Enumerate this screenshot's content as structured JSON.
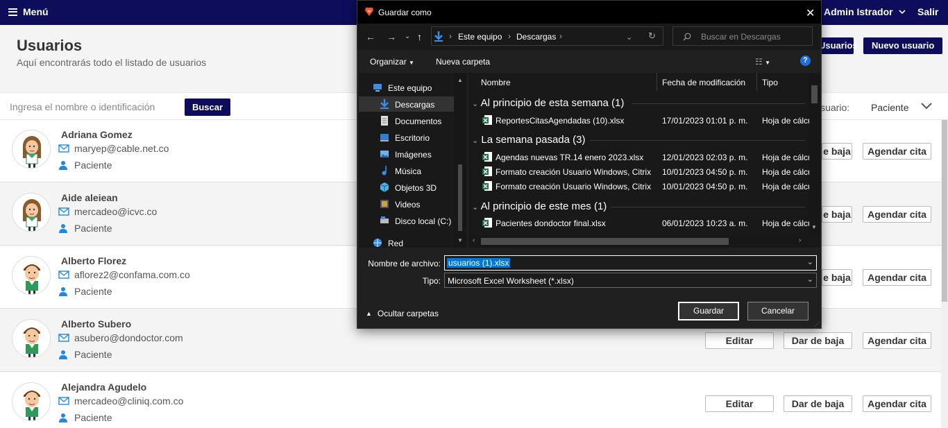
{
  "topbar": {
    "menu_label": "Menú",
    "user_label": "Admin Istrador",
    "logout_label": "Salir"
  },
  "header": {
    "title": "Usuarios",
    "subtitle": "Aquí encontrarás todo el listado de usuarios",
    "btn_partial": "Usuarios",
    "btn_new_user": "Nuevo usuario"
  },
  "search": {
    "placeholder": "Ingresa el nombre o identificación",
    "button": "Buscar",
    "filter_label": "Usuario:",
    "filter_value": "Paciente"
  },
  "users": [
    {
      "name": "Adriana Gomez",
      "email": "maryep@cable.net.co",
      "role": "Paciente",
      "gender": "female"
    },
    {
      "name": "Aide aleiean",
      "email": "mercadeo@icvc.co",
      "role": "Paciente",
      "gender": "female"
    },
    {
      "name": "Alberto Florez",
      "email": "aflorez2@confama.com.co",
      "role": "Paciente",
      "gender": "male"
    },
    {
      "name": "Alberto Subero",
      "email": "asubero@dondoctor.com",
      "role": "Paciente",
      "gender": "male"
    },
    {
      "name": "Alejandra Agudelo",
      "email": "mercadeo@cliniq.com.co",
      "role": "Paciente",
      "gender": "male"
    }
  ],
  "row_actions": {
    "edit": "Editar",
    "deactivate": "Dar de baja",
    "deactivate_partial": "e baja",
    "schedule": "Agendar cita"
  },
  "dialog": {
    "title": "Guardar como",
    "address": [
      "Este equipo",
      "Descargas"
    ],
    "search_placeholder": "Buscar en Descargas",
    "organize": "Organizar",
    "new_folder": "Nueva carpeta",
    "nav_items": [
      {
        "label": "Este equipo",
        "icon": "computer-icon"
      },
      {
        "label": "Descargas",
        "icon": "download-icon"
      },
      {
        "label": "Documentos",
        "icon": "document-icon"
      },
      {
        "label": "Escritorio",
        "icon": "desktop-icon"
      },
      {
        "label": "Imágenes",
        "icon": "pictures-icon"
      },
      {
        "label": "Música",
        "icon": "music-icon"
      },
      {
        "label": "Objetos 3D",
        "icon": "cube-icon"
      },
      {
        "label": "Videos",
        "icon": "video-icon"
      },
      {
        "label": "Disco local (C:)",
        "icon": "disk-icon"
      },
      {
        "label": "Red",
        "icon": "network-icon"
      }
    ],
    "columns": {
      "name": "Nombre",
      "date": "Fecha de modificación",
      "type": "Tipo"
    },
    "groups": [
      {
        "label": "Al principio de esta semana (1)",
        "files": [
          {
            "name": "ReportesCitasAgendadas (10).xlsx",
            "date": "17/01/2023 01:01 p. m.",
            "type": "Hoja de cálculo"
          }
        ]
      },
      {
        "label": "La semana pasada (3)",
        "files": [
          {
            "name": "Agendas nuevas TR.14 enero 2023.xlsx",
            "date": "12/01/2023 02:03 p. m.",
            "type": "Hoja de cálculo"
          },
          {
            "name": "Formato creación Usuario Windows, Citrix.xlsx",
            "date": "10/01/2023 04:50 p. m.",
            "type": "Hoja de cálculo"
          },
          {
            "name": "Formato creación Usuario Windows, Citrix.xlsx",
            "date": "10/01/2023 04:50 p. m.",
            "type": "Hoja de cálculo"
          }
        ]
      },
      {
        "label": "Al principio de este mes (1)",
        "files": [
          {
            "name": "Pacientes dondoctor final.xlsx",
            "date": "06/01/2023 10:23 a. m.",
            "type": "Hoja de cálculo"
          }
        ]
      }
    ],
    "filename_label": "Nombre de archivo:",
    "filename_value": "usuarios (1).xlsx",
    "type_label": "Tipo:",
    "type_value": "Microsoft Excel Worksheet (*.xlsx)",
    "hide_folders": "Ocultar carpetas",
    "save": "Guardar",
    "cancel": "Cancelar"
  }
}
